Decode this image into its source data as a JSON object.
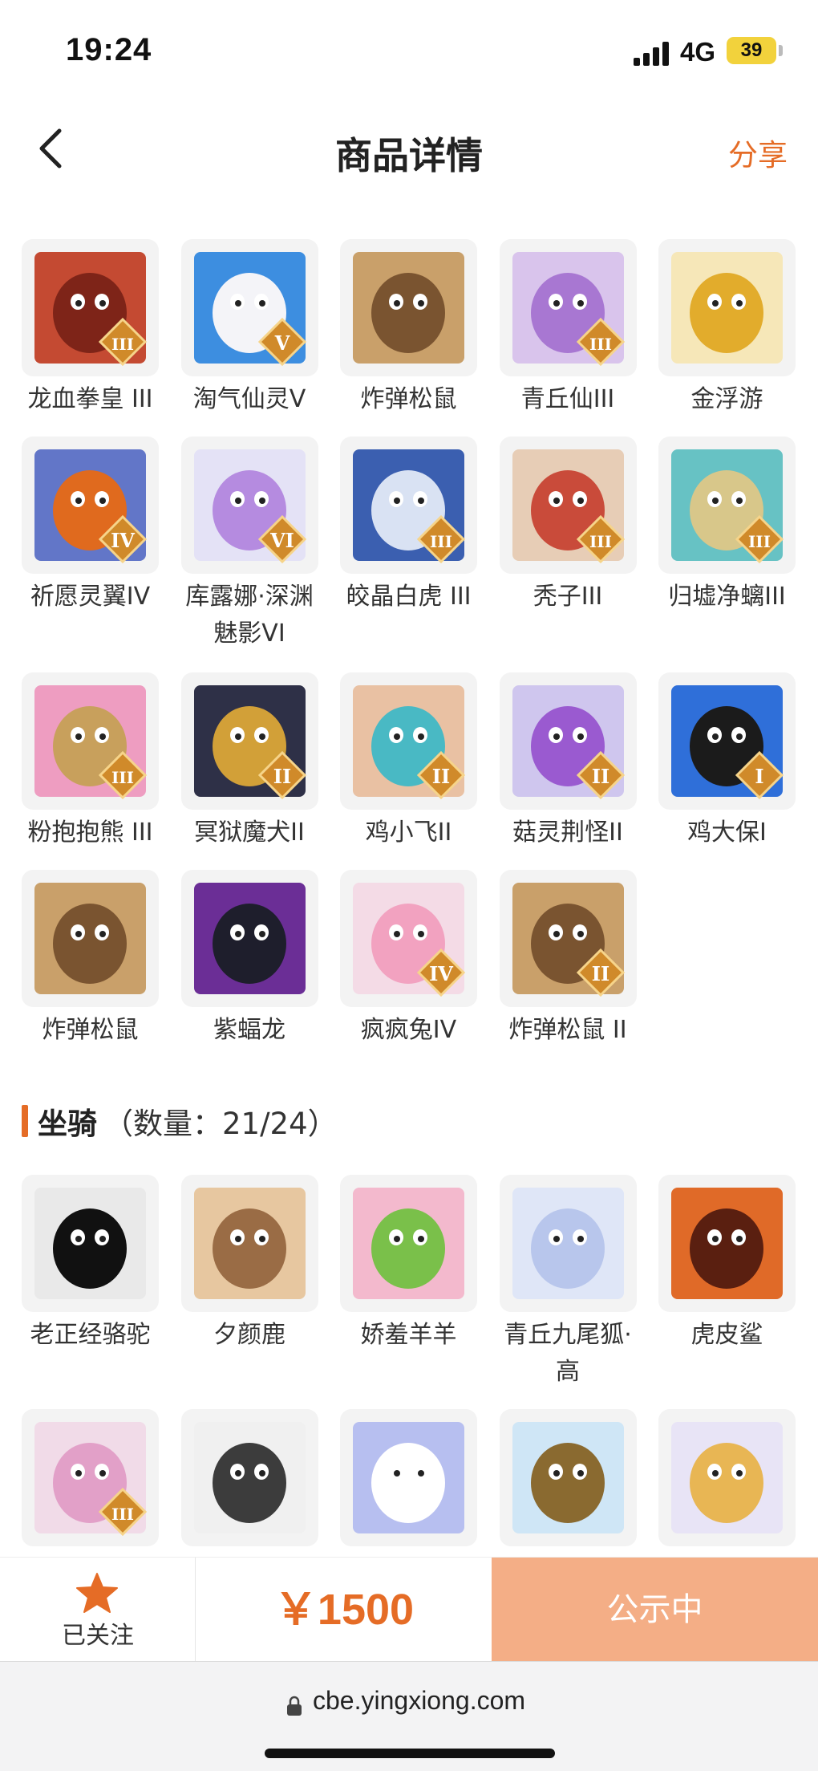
{
  "status_bar": {
    "time": "19:24",
    "network": "4G",
    "battery": "39"
  },
  "header": {
    "title": "商品详情",
    "share": "分享"
  },
  "skins": [
    {
      "label": "龙血拳皇 III",
      "bg": "#c44a32",
      "fg": "#7e2418",
      "badge": "III"
    },
    {
      "label": "淘气仙灵V",
      "bg": "#3d8ee0",
      "fg": "#f4f4f8",
      "badge": "V"
    },
    {
      "label": "炸弹松鼠",
      "bg": "#c9a06a",
      "fg": "#7a5430",
      "badge": ""
    },
    {
      "label": "青丘仙III",
      "bg": "#d9c4ec",
      "fg": "#a877d2",
      "badge": "III"
    },
    {
      "label": "金浮游",
      "bg": "#f6e7b8",
      "fg": "#e2ac2c",
      "badge": ""
    },
    {
      "label": "祈愿灵翼IV",
      "bg": "#6276c8",
      "fg": "#e06a1e",
      "badge": "IV"
    },
    {
      "label": "库露娜·深渊魅影VI",
      "bg": "#e4e2f6",
      "fg": "#b58be0",
      "badge": "VI"
    },
    {
      "label": "皎晶白虎 III",
      "bg": "#3b5fb0",
      "fg": "#d9e2f3",
      "badge": "III"
    },
    {
      "label": "秃子III",
      "bg": "#e7cdb6",
      "fg": "#c94b3a",
      "badge": "III"
    },
    {
      "label": "归墟净螭III",
      "bg": "#67c2c4",
      "fg": "#d8c78a",
      "badge": "III"
    },
    {
      "label": "粉抱抱熊 III",
      "bg": "#ee9dc1",
      "fg": "#c8a05c",
      "badge": "III"
    },
    {
      "label": "冥狱魔犬II",
      "bg": "#2e3047",
      "fg": "#d2a038",
      "badge": "II"
    },
    {
      "label": "鸡小飞II",
      "bg": "#e9c1a3",
      "fg": "#49b9c4",
      "badge": "II"
    },
    {
      "label": "菇灵荆怪II",
      "bg": "#cfc6ee",
      "fg": "#9a5ad0",
      "badge": "II"
    },
    {
      "label": "鸡大保I",
      "bg": "#2f6fd9",
      "fg": "#1b1b1b",
      "badge": "I"
    },
    {
      "label": "炸弹松鼠",
      "bg": "#c9a06a",
      "fg": "#7a5430",
      "badge": ""
    },
    {
      "label": "紫蝠龙",
      "bg": "#6b2e96",
      "fg": "#1e1e2c",
      "badge": ""
    },
    {
      "label": "疯疯兔IV",
      "bg": "#f4dbe6",
      "fg": "#f2a2c0",
      "badge": "IV"
    },
    {
      "label": "炸弹松鼠 II",
      "bg": "#c9a06a",
      "fg": "#7a5430",
      "badge": "II"
    }
  ],
  "mounts_section": {
    "title": "坐骑",
    "count": "（数量：21/24）"
  },
  "mounts": [
    {
      "label": "老正经骆驼",
      "bg": "#e9e9e9",
      "fg": "#111111",
      "badge": ""
    },
    {
      "label": "夕颜鹿",
      "bg": "#e7c7a0",
      "fg": "#9a6c45",
      "badge": ""
    },
    {
      "label": "娇羞羊羊",
      "bg": "#f3b9cd",
      "fg": "#7ac04a",
      "badge": ""
    },
    {
      "label": "青丘九尾狐·高",
      "bg": "#dfe6f7",
      "fg": "#b8c6ec",
      "badge": ""
    },
    {
      "label": "虎皮鲨",
      "bg": "#e06a28",
      "fg": "#5a1f10",
      "badge": ""
    },
    {
      "label": "",
      "bg": "#f1dbe8",
      "fg": "#e2a0c8",
      "badge": "III"
    },
    {
      "label": "",
      "bg": "#f0f0f0",
      "fg": "#3c3c3c",
      "badge": ""
    },
    {
      "label": "",
      "bg": "#b7bff0",
      "fg": "#ffffff",
      "badge": ""
    },
    {
      "label": "",
      "bg": "#cfe6f6",
      "fg": "#8a6a30",
      "badge": ""
    },
    {
      "label": "",
      "bg": "#e8e4f6",
      "fg": "#e8b654",
      "badge": ""
    }
  ],
  "action_bar": {
    "follow_label": "已关注",
    "price": "￥1500",
    "status_button": "公示中"
  },
  "browser": {
    "url": "cbe.yingxiong.com"
  },
  "colors": {
    "accent": "#e56c26",
    "button_bg": "#f4ae86",
    "tile_bg": "#f3f3f3"
  }
}
